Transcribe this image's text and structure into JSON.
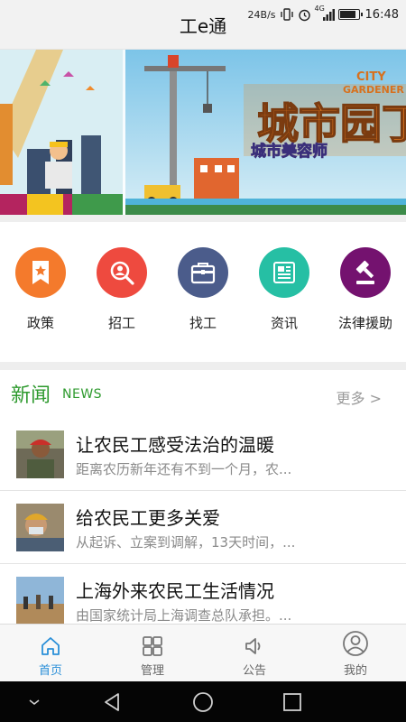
{
  "app": {
    "title": "工e通"
  },
  "status_bar": {
    "speed": "24B/s",
    "network": "4G",
    "time": "16:48",
    "battery_level": 0.9
  },
  "banner": {
    "logo_main": "城市园丁",
    "logo_en_top": "CITY",
    "logo_en_bottom": "GARDENER",
    "logo_sub": "城市美容师"
  },
  "categories": [
    {
      "label": "政策",
      "icon": "bookmark-star-icon",
      "color": "#f47a2c"
    },
    {
      "label": "招工",
      "icon": "search-person-icon",
      "color": "#ee4a3f"
    },
    {
      "label": "找工",
      "icon": "briefcase-icon",
      "color": "#4b5c8b"
    },
    {
      "label": "资讯",
      "icon": "news-document-icon",
      "color": "#26bfa4"
    },
    {
      "label": "法律援助",
      "icon": "gavel-icon",
      "color": "#74126f"
    }
  ],
  "news": {
    "title": "新闻",
    "subtitle": "NEWS",
    "more_label": "更多 >",
    "items": [
      {
        "title": "让农民工感受法治的温暖",
        "summary": "距离农历新年还有不到一个月，农..."
      },
      {
        "title": "给农民工更多关爱",
        "summary": "从起诉、立案到调解，13天时间，..."
      },
      {
        "title": "上海外来农民工生活情况",
        "summary": "由国家统计局上海调查总队承担。..."
      }
    ]
  },
  "tabs": [
    {
      "label": "首页",
      "icon": "home-icon",
      "active": true
    },
    {
      "label": "管理",
      "icon": "grid-manage-icon",
      "active": false
    },
    {
      "label": "公告",
      "icon": "speaker-icon",
      "active": false
    },
    {
      "label": "我的",
      "icon": "user-profile-icon",
      "active": false
    }
  ],
  "colors": {
    "accent_green": "#2e9a2e",
    "tab_active": "#2a8fd8"
  }
}
